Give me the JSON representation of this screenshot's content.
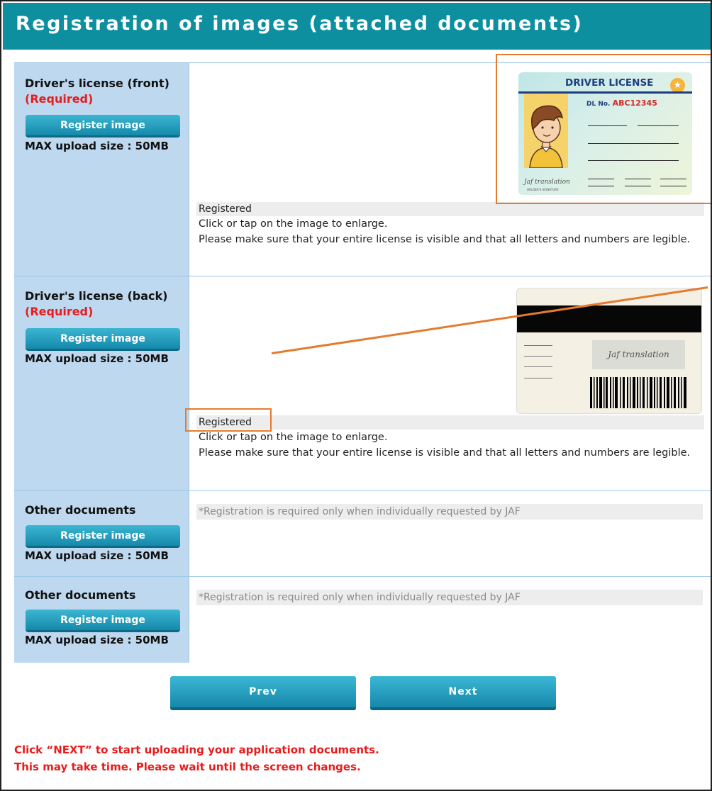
{
  "header": {
    "title": "Registration of images (attached documents)"
  },
  "rows": [
    {
      "title": "Driver's license (front)",
      "required": "(Required)",
      "button": "Register image",
      "max_size": "MAX upload size : 50MB",
      "status": "Registered",
      "help_1": "Click or tap on the image to enlarge.",
      "help_2": "Please make sure that your entire license is visible and that all letters and numbers are legible."
    },
    {
      "title": "Driver's license (back)",
      "required": "(Required)",
      "button": "Register image",
      "max_size": "MAX upload size : 50MB",
      "status": "Registered",
      "help_1": "Click or tap on the image to enlarge.",
      "help_2": "Please make sure that your entire license is visible and that all letters and numbers are legible."
    },
    {
      "title": "Other documents",
      "button": "Register image",
      "max_size": "MAX upload size : 50MB",
      "note": "*Registration is required only when individually requested by JAF"
    },
    {
      "title": "Other documents",
      "button": "Register image",
      "max_size": "MAX upload size : 50MB",
      "note": "*Registration is required only when individually requested by JAF"
    }
  ],
  "license_front": {
    "title": "DRIVER LICENSE",
    "dl_label": "DL No.",
    "dl_number": "ABC12345",
    "signature": "Jaf translation",
    "signature_caption": "HOLDER'S SIGNATURE"
  },
  "license_back": {
    "signature": "Jaf translation"
  },
  "navigation": {
    "prev": "Prev",
    "next": "Next"
  },
  "notice": {
    "line1": "Click “NEXT” to start uploading your application documents.",
    "line2": "This may take time. Please wait until the screen changes."
  },
  "colors": {
    "header_bg": "#0d8fa0",
    "label_bg": "#bed8ef",
    "button": "#1b93b4",
    "required": "#e81c1c",
    "highlight": "#e57b2e"
  }
}
